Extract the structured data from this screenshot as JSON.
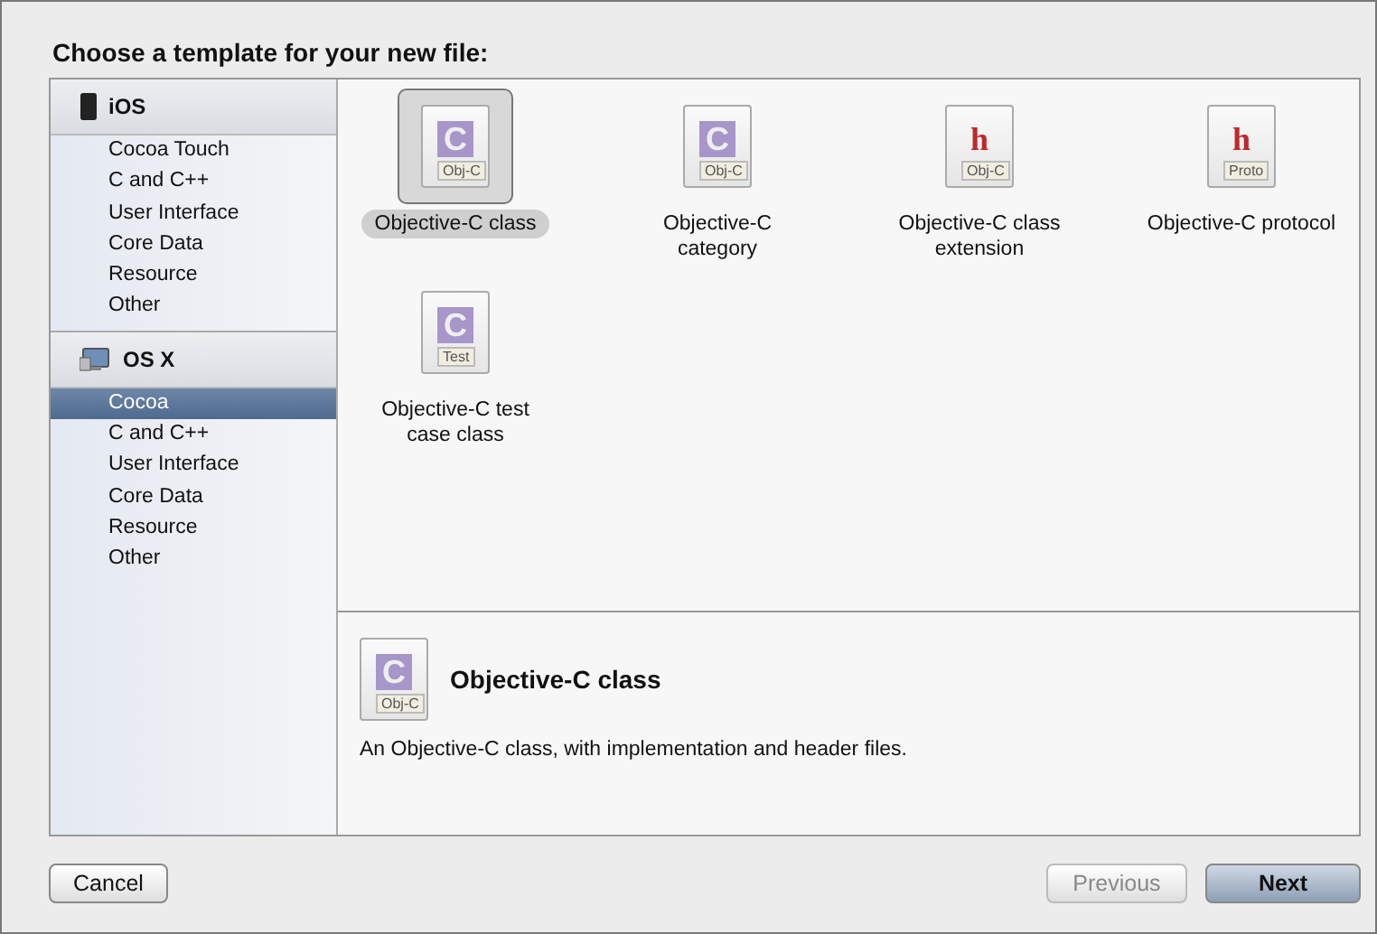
{
  "title": "Choose a template for your new file:",
  "sidebar": {
    "sections": [
      {
        "label": "iOS",
        "kind": "phone",
        "items": [
          {
            "label": "Cocoa Touch",
            "selected": false
          },
          {
            "label": "C and C++",
            "selected": false
          },
          {
            "label": "User Interface",
            "selected": false
          },
          {
            "label": "Core Data",
            "selected": false
          },
          {
            "label": "Resource",
            "selected": false
          },
          {
            "label": "Other",
            "selected": false
          }
        ]
      },
      {
        "label": "OS X",
        "kind": "desktop",
        "items": [
          {
            "label": "Cocoa",
            "selected": true
          },
          {
            "label": "C and C++",
            "selected": false
          },
          {
            "label": "User Interface",
            "selected": false
          },
          {
            "label": "Core Data",
            "selected": false
          },
          {
            "label": "Resource",
            "selected": false
          },
          {
            "label": "Other",
            "selected": false
          }
        ]
      }
    ]
  },
  "templates": [
    {
      "label": "Objective-C class",
      "glyph": "C",
      "badge": "Obj-C",
      "kind": "source",
      "selected": true
    },
    {
      "label": "Objective-C category",
      "glyph": "C",
      "badge": "Obj-C",
      "kind": "source",
      "selected": false
    },
    {
      "label": "Objective-C class extension",
      "glyph": "h",
      "badge": "Obj-C",
      "kind": "header",
      "selected": false
    },
    {
      "label": "Objective-C protocol",
      "glyph": "h",
      "badge": "Proto",
      "kind": "header",
      "selected": false
    },
    {
      "label": "Objective-C test case class",
      "glyph": "C",
      "badge": "Test",
      "kind": "source",
      "selected": false
    }
  ],
  "detail": {
    "title": "Objective-C class",
    "glyph": "C",
    "badge": "Obj-C",
    "kind": "source",
    "description": "An Objective-C class, with implementation and header files."
  },
  "buttons": [
    {
      "label": "Cancel",
      "kind": "normal",
      "disabled": false
    },
    {
      "label": "Previous",
      "kind": "normal",
      "disabled": true
    },
    {
      "label": "Next",
      "kind": "default",
      "disabled": false
    }
  ]
}
